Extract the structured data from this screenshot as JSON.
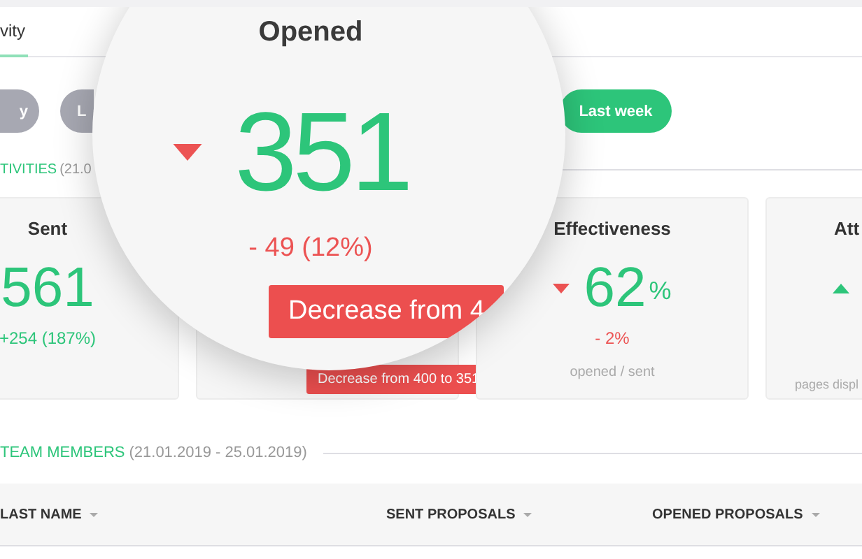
{
  "tabs": [
    {
      "label": "vity",
      "selected": true
    }
  ],
  "filters": [
    {
      "label": "y",
      "selected": false
    },
    {
      "label": "L",
      "selected": false
    },
    {
      "label": "Last week",
      "selected": true
    }
  ],
  "activities": {
    "title": "TIVITIES",
    "range": "(21.0"
  },
  "cards": [
    {
      "title": "Sent",
      "value": "561",
      "change": "+254 (187%)",
      "negative": false
    },
    {
      "tooltip": "Decrease from 400 to 351"
    },
    {
      "title": "Effectiveness",
      "rising": false,
      "value": "62",
      "unit": "%",
      "change": "- 2%",
      "negative": true,
      "note": "opened / sent"
    },
    {
      "title": "Att",
      "rising": true,
      "note": "pages displ"
    }
  ],
  "magnifier": {
    "title": "Opened",
    "rising": false,
    "value": "351",
    "change": "- 49 (12%)",
    "negative": true,
    "tooltip": "Decrease from 4"
  },
  "team": {
    "title": "TEAM MEMBERS",
    "range": "(21.01.2019 - 25.01.2019)"
  },
  "table": {
    "columns": [
      {
        "label": "LAST NAME"
      },
      {
        "label": "SENT PROPOSALS"
      },
      {
        "label": "OPENED PROPOSALS"
      }
    ]
  }
}
